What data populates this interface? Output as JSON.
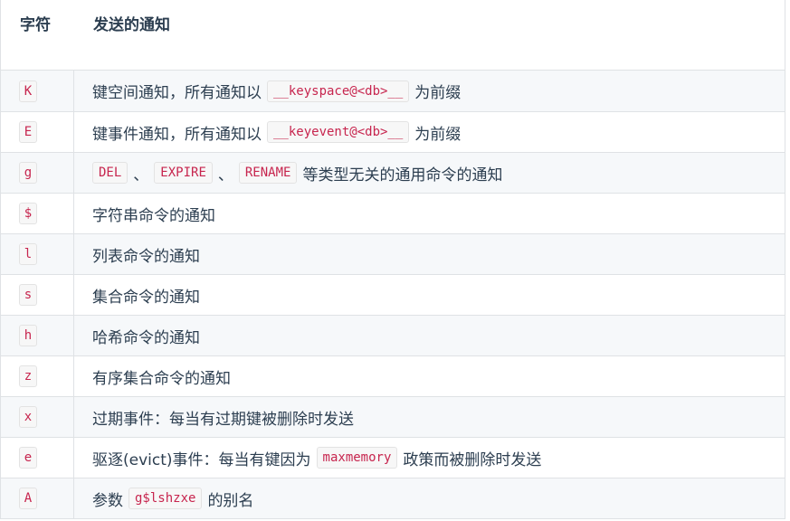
{
  "table": {
    "headers": {
      "flag": "字符",
      "notification": "发送的通知"
    },
    "rows": [
      {
        "flag": "K",
        "parts": [
          {
            "type": "text",
            "value": "键空间通知，所有通知以"
          },
          {
            "type": "code",
            "value": "__keyspace@<db>__"
          },
          {
            "type": "text",
            "value": "为前缀"
          }
        ]
      },
      {
        "flag": "E",
        "parts": [
          {
            "type": "text",
            "value": "键事件通知，所有通知以"
          },
          {
            "type": "code",
            "value": "__keyevent@<db>__"
          },
          {
            "type": "text",
            "value": "为前缀"
          }
        ]
      },
      {
        "flag": "g",
        "parts": [
          {
            "type": "code",
            "value": "DEL"
          },
          {
            "type": "text",
            "value": "、"
          },
          {
            "type": "code",
            "value": "EXPIRE"
          },
          {
            "type": "text",
            "value": "、"
          },
          {
            "type": "code",
            "value": "RENAME"
          },
          {
            "type": "text",
            "value": "等类型无关的通用命令的通知"
          }
        ]
      },
      {
        "flag": "$",
        "parts": [
          {
            "type": "text",
            "value": "字符串命令的通知"
          }
        ]
      },
      {
        "flag": "l",
        "parts": [
          {
            "type": "text",
            "value": "列表命令的通知"
          }
        ]
      },
      {
        "flag": "s",
        "parts": [
          {
            "type": "text",
            "value": "集合命令的通知"
          }
        ]
      },
      {
        "flag": "h",
        "parts": [
          {
            "type": "text",
            "value": "哈希命令的通知"
          }
        ]
      },
      {
        "flag": "z",
        "parts": [
          {
            "type": "text",
            "value": "有序集合命令的通知"
          }
        ]
      },
      {
        "flag": "x",
        "parts": [
          {
            "type": "text",
            "value": "过期事件：每当有过期键被删除时发送"
          }
        ]
      },
      {
        "flag": "e",
        "parts": [
          {
            "type": "text",
            "value": "驱逐(evict)事件：每当有键因为"
          },
          {
            "type": "code",
            "value": "maxmemory"
          },
          {
            "type": "text",
            "value": "政策而被删除时发送"
          }
        ]
      },
      {
        "flag": "A",
        "parts": [
          {
            "type": "text",
            "value": "参数"
          },
          {
            "type": "code",
            "value": "g$lshzxe"
          },
          {
            "type": "text",
            "value": "的别名"
          }
        ]
      }
    ]
  }
}
